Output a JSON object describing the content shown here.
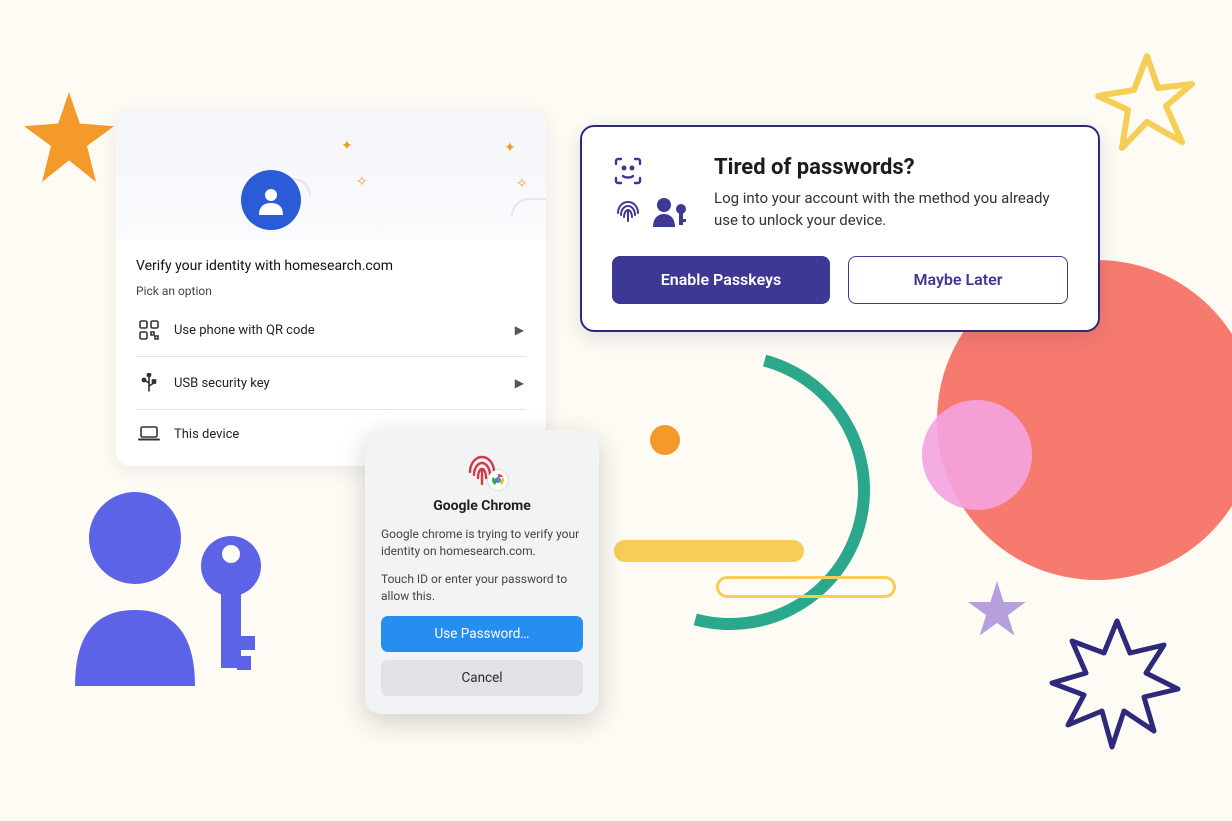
{
  "verify": {
    "title": "Verify your identity with homesearch.com",
    "subtitle": "Pick an option",
    "options": [
      {
        "icon": "qr-icon",
        "label": "Use phone with QR code"
      },
      {
        "icon": "usb-icon",
        "label": "USB security key"
      },
      {
        "icon": "laptop-icon",
        "label": "This device"
      }
    ]
  },
  "promo": {
    "title": "Tired of passwords?",
    "desc": "Log into your account with the method you already use to unlock your device.",
    "primary_label": "Enable Passkeys",
    "secondary_label": "Maybe Later"
  },
  "chrome": {
    "app": "Google Chrome",
    "line1": "Google chrome is trying to verify your identity on homesearch.com.",
    "line2": "Touch ID or enter your password to allow this.",
    "primary_label": "Use Password…",
    "secondary_label": "Cancel"
  },
  "colors": {
    "indigo": "#3D3894",
    "coral": "#F77A6F",
    "orange": "#F39A2B",
    "teal": "#2BA88B",
    "yellow": "#F6CE55",
    "blue": "#268EF0"
  }
}
